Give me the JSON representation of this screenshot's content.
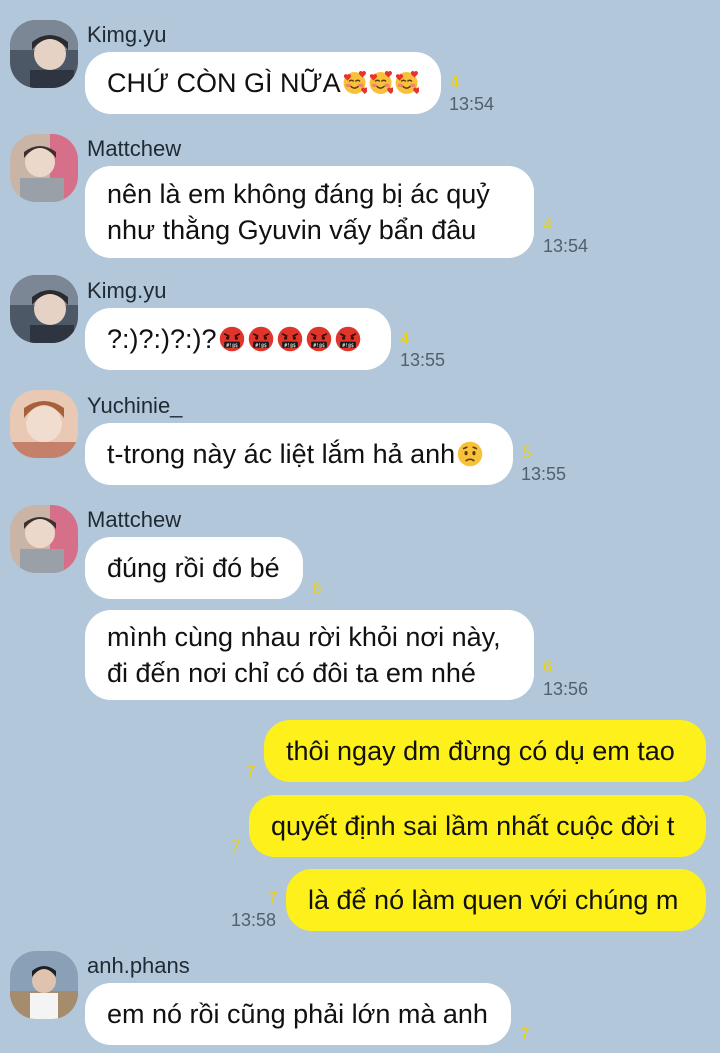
{
  "colors": {
    "background": "#b2c7d9",
    "incoming": "#ffffff",
    "outgoing": "#fef01b",
    "unread": "#f2d200"
  },
  "messages": [
    {
      "sender": "Kimg.yu",
      "text": "CHỨ CÒN GÌ NỮA",
      "emojis": [
        "smiling-hearts-icon",
        "smiling-hearts-icon",
        "smiling-hearts-icon"
      ],
      "unread": "4",
      "time": "13:54"
    },
    {
      "sender": "Mattchew",
      "lines": [
        "nên là em không đáng bị ác quỷ",
        "như thằng Gyuvin vấy bẩn đâu"
      ],
      "unread": "4",
      "time": "13:54"
    },
    {
      "sender": "Kimg.yu",
      "text": "?:)?:)?:)?",
      "emojis": [
        "cursing-face-icon",
        "cursing-face-icon",
        "cursing-face-icon",
        "cursing-face-icon",
        "cursing-face-icon"
      ],
      "unread": "4",
      "time": "13:55"
    },
    {
      "sender": "Yuchinie_",
      "text": "t-trong này ác liệt lắm hả anh",
      "emojis": [
        "worried-face-icon"
      ],
      "unread": "5",
      "time": "13:55"
    },
    {
      "sender": "Mattchew",
      "text": "đúng rồi đó bé",
      "unread": "6"
    },
    {
      "lines": [
        "mình cùng nhau rời khỏi nơi này,",
        "đi đến nơi chỉ có đôi ta em nhé"
      ],
      "unread": "6",
      "time": "13:56"
    },
    {
      "text": "thôi ngay dm đừng có dụ em tao",
      "unread": "7"
    },
    {
      "text": "quyết định sai lầm nhất cuộc đời t",
      "unread": "7"
    },
    {
      "text": "là để nó làm quen với chúng m",
      "unread": "7",
      "time": "13:58"
    },
    {
      "sender": "anh.phans",
      "text": "em nó rồi cũng phải lớn mà anh",
      "unread": "7"
    }
  ]
}
